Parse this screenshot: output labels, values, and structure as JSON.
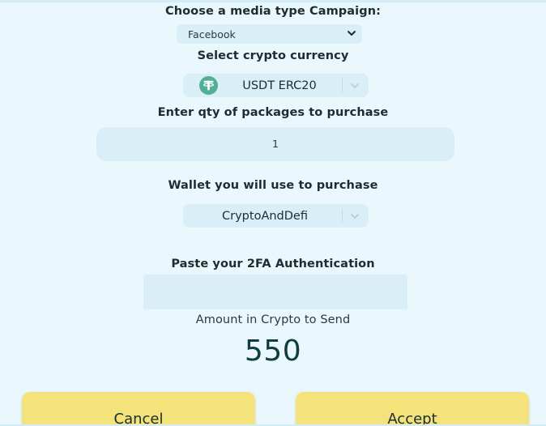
{
  "campaign": {
    "label": "Choose a media type Campaign:",
    "selected": "Facebook"
  },
  "currency": {
    "label": "Select crypto currency",
    "selected": "USDT ERC20",
    "icon": "tether-icon",
    "icon_color": "#50af95"
  },
  "qty": {
    "label": "Enter qty of packages to purchase",
    "value": "1"
  },
  "wallet": {
    "label": "Wallet you will use to purchase",
    "selected": "CryptoAndDefi"
  },
  "twofa": {
    "label": "Paste your 2FA Authentication",
    "value": ""
  },
  "amount": {
    "label": "Amount in Crypto to Send",
    "value": "550"
  },
  "buttons": {
    "cancel_label": "Cancel",
    "accept_label": "Accept",
    "color": "#f4e27a"
  }
}
